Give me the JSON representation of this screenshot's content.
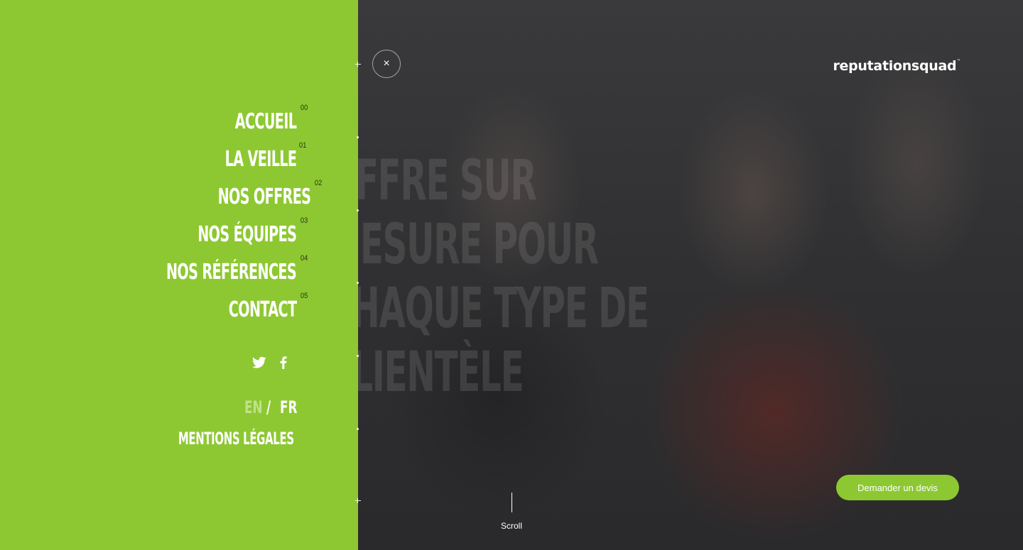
{
  "hero": {
    "lines": [
      "OFFRE SUR",
      "MESURE POUR",
      "CHAQUE TYPE DE",
      "CLIENTÈLE"
    ]
  },
  "logo": {
    "text": "reputationsquad",
    "tm": "™"
  },
  "menu": {
    "items": [
      {
        "label": "ACCUEIL",
        "num": "00"
      },
      {
        "label": "LA VEILLE",
        "num": "01"
      },
      {
        "label": "NOS OFFRES",
        "num": "02"
      },
      {
        "label": "NOS ÉQUIPES",
        "num": "03"
      },
      {
        "label": "NOS RÉFÉRENCES",
        "num": "04"
      },
      {
        "label": "CONTACT",
        "num": "05"
      }
    ],
    "social": {
      "twitter": "twitter-icon",
      "facebook": "facebook-icon"
    },
    "lang": {
      "en": "EN",
      "sep": "/",
      "fr": "FR"
    },
    "legal": "MENTIONS LÉGALES"
  },
  "close_icon": "×",
  "cta": {
    "label": "Demander un devis"
  },
  "scroll": {
    "label": "Scroll"
  },
  "colors": {
    "accent": "#8dc832",
    "background": "#2f2f31",
    "number": "#2b3314"
  }
}
